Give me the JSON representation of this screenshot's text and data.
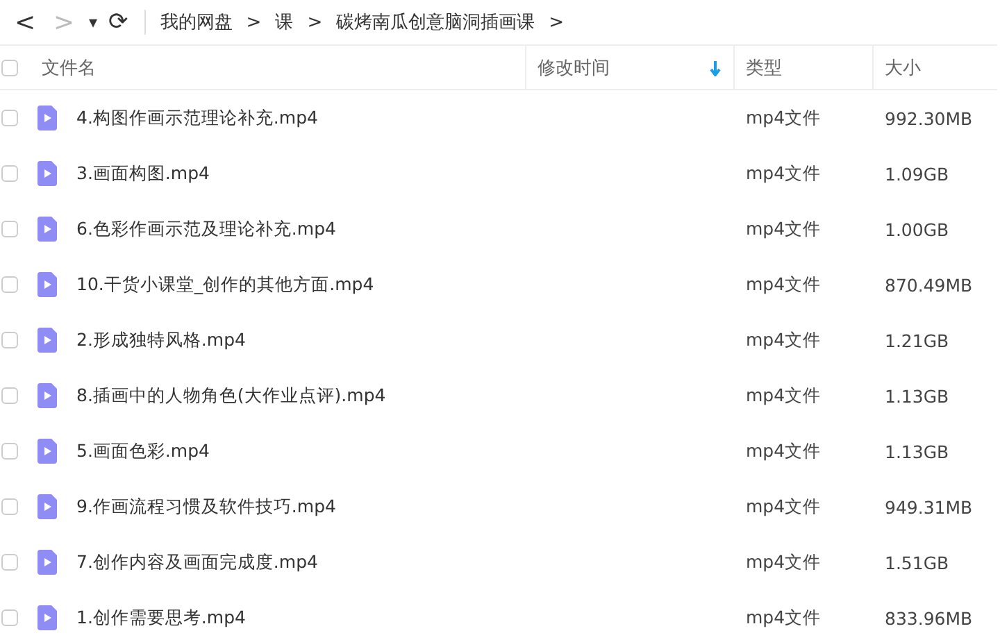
{
  "nav": {
    "back": "<",
    "forward": ">",
    "dropdown": "▾",
    "refresh": "⟳"
  },
  "breadcrumbs": [
    {
      "label": "我的网盘",
      "separator": ">"
    },
    {
      "label": "课",
      "separator": ">"
    },
    {
      "label": "碳烤南瓜创意脑洞插画课",
      "separator": ">"
    }
  ],
  "table": {
    "select_all": {
      "checked": false
    },
    "columns": [
      {
        "label": "文件名",
        "sorted": false
      },
      {
        "label": "修改时间",
        "sorted": true
      },
      {
        "label": "类型",
        "sorted": false
      },
      {
        "label": "大小",
        "sorted": false
      }
    ],
    "rows": [
      {
        "name": "4.构图作画示范理论补充.mp4",
        "type": "mp4文件",
        "size": "992.30MB",
        "checked": false
      },
      {
        "name": "3.画面构图.mp4",
        "type": "mp4文件",
        "size": "1.09GB",
        "checked": false
      },
      {
        "name": "6.色彩作画示范及理论补充.mp4",
        "type": "mp4文件",
        "size": "1.00GB",
        "checked": false
      },
      {
        "name": "10.干货小课堂_创作的其他方面.mp4",
        "type": "mp4文件",
        "size": "870.49MB",
        "checked": false
      },
      {
        "name": "2.形成独特风格.mp4",
        "type": "mp4文件",
        "size": "1.21GB",
        "checked": false
      },
      {
        "name": "8.插画中的人物角色(大作业点评).mp4",
        "type": "mp4文件",
        "size": "1.13GB",
        "checked": false
      },
      {
        "name": "5.画面色彩.mp4",
        "type": "mp4文件",
        "size": "1.13GB",
        "checked": false
      },
      {
        "name": "9.作画流程习惯及软件技巧.mp4",
        "type": "mp4文件",
        "size": "949.31MB",
        "checked": false
      },
      {
        "name": "7.创作内容及画面完成度.mp4",
        "type": "mp4文件",
        "size": "1.51GB",
        "checked": false
      },
      {
        "name": "1.创作需要思考.mp4",
        "type": "mp4文件",
        "size": "833.96MB",
        "checked": false
      }
    ]
  }
}
